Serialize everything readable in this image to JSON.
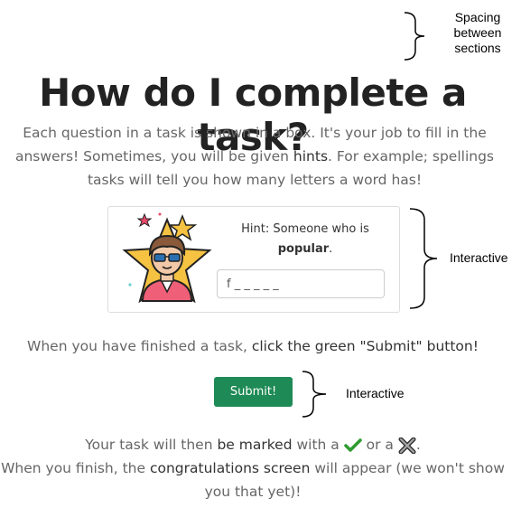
{
  "annotations": {
    "top": "Spacing between sections",
    "card": "Interactive",
    "button": "Interactive"
  },
  "title": "How do I complete a task?",
  "intro": {
    "p1": "Each question in a task is shown in a box. It's your job to fill in the answers! Sometimes, you will be given ",
    "hints_word": "hints",
    "p2": ". For example; spellings tasks will tell you how many letters a word has!"
  },
  "card": {
    "hint_prefix": "Hint: Someone who is",
    "hint_word": "popular",
    "hint_suffix": ".",
    "answer_value": "f _ _ _ _ _"
  },
  "finish_line": {
    "pre": "When you have finished a task, ",
    "bold": "click the green \"Submit\" button!"
  },
  "submit_label": "Submit!",
  "bottom": {
    "a": "Your task will then ",
    "a_bold": "be marked",
    "b": " with a ",
    "c": " or a ",
    "d": ".",
    "e": "When you finish, the ",
    "e_bold": "congratulations screen",
    "f": " will appear (we won't show you that yet)!"
  },
  "colors": {
    "submit_bg": "#1e8a55",
    "check": "#2e9b2e",
    "cross": "#555555"
  }
}
